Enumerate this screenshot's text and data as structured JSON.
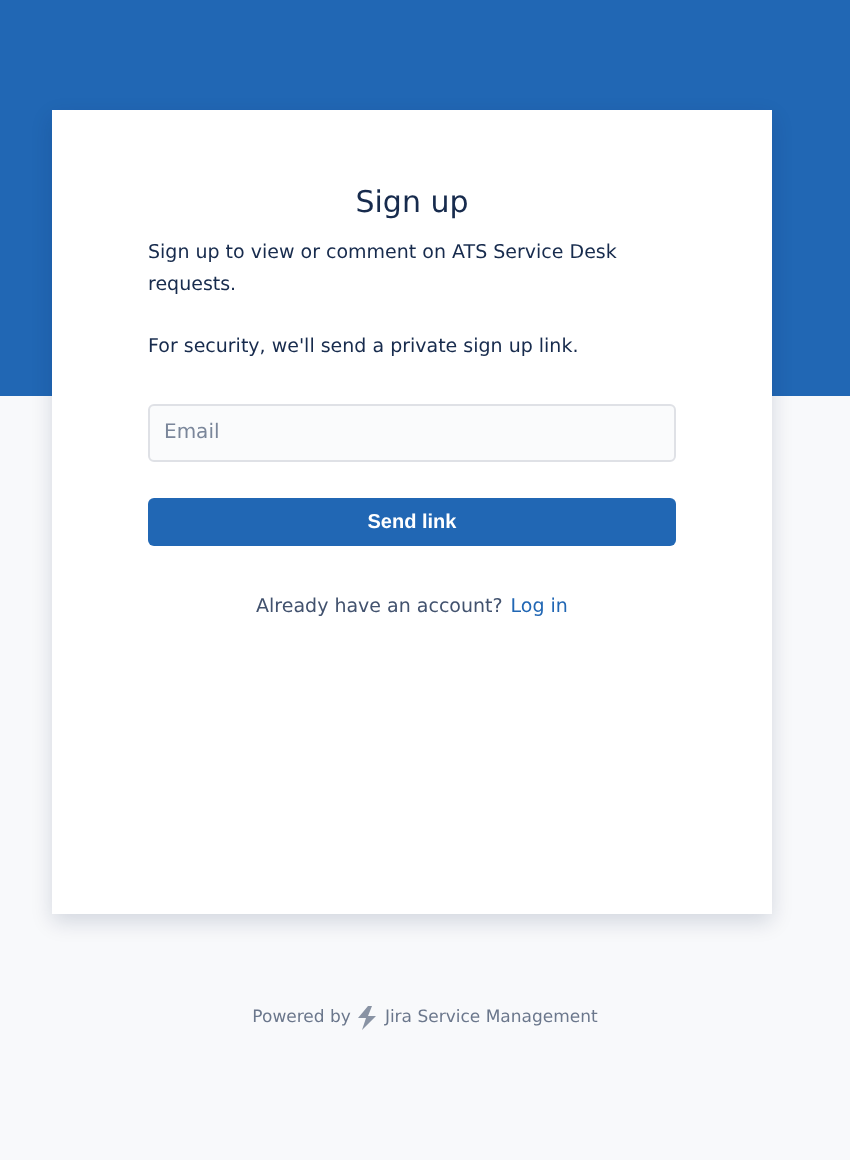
{
  "card": {
    "title": "Sign up",
    "intro": "Sign up to view or comment on ATS Service Desk requests.",
    "security_note": "For security, we'll send a private sign up link.",
    "email_field": {
      "placeholder": "Email"
    },
    "submit_button": "Send link",
    "login_prompt": {
      "text": "Already have an account?",
      "link": "Log in"
    }
  },
  "footer": {
    "prefix": "Powered by",
    "product": "Jira Service Management"
  }
}
